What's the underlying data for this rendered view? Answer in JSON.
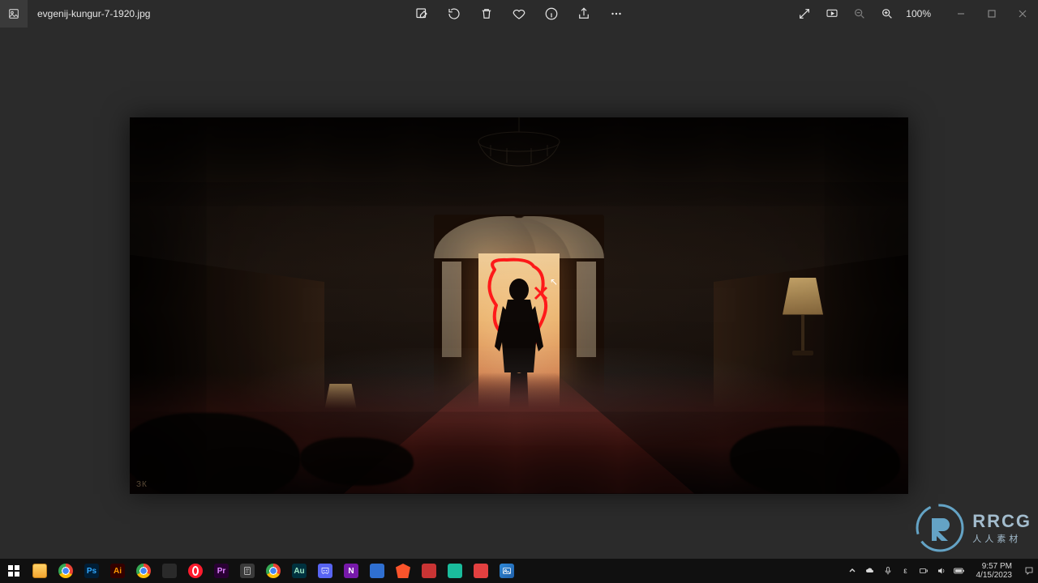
{
  "titlebar": {
    "filename": "evgenij-kungur-7-1920.jpg",
    "zoom_level": "100%"
  },
  "toolbar_icons": {
    "edit": "edit-icon",
    "rotate": "rotate-icon",
    "delete": "delete-icon",
    "favorite": "favorite-icon",
    "info": "info-icon",
    "share": "share-icon",
    "more": "more-icon",
    "fullscreen": "fullscreen-icon",
    "slideshow": "slideshow-icon",
    "zoom_out": "zoom-out-icon",
    "zoom_in": "zoom-in-icon"
  },
  "window_controls": {
    "minimize": "minimize",
    "maximize": "maximize",
    "close": "close"
  },
  "artwork": {
    "signature": "ЗК"
  },
  "taskbar": {
    "items": [
      {
        "name": "start",
        "label": ""
      },
      {
        "name": "file-explorer",
        "label": "",
        "bg": "#f8c155"
      },
      {
        "name": "chrome-1",
        "label": "",
        "bg": "#ffffff"
      },
      {
        "name": "photoshop",
        "label": "Ps",
        "bg": "#001e36",
        "fg": "#31a8ff"
      },
      {
        "name": "illustrator",
        "label": "Ai",
        "bg": "#330000",
        "fg": "#ff9a00"
      },
      {
        "name": "chrome-2",
        "label": "",
        "bg": "#ffffff"
      },
      {
        "name": "app-dark-1",
        "label": "",
        "bg": "#2a2a2a"
      },
      {
        "name": "opera",
        "label": "",
        "bg": "#ff1b2d"
      },
      {
        "name": "premiere",
        "label": "Pr",
        "bg": "#2a0034",
        "fg": "#e085ff"
      },
      {
        "name": "calculator",
        "label": "",
        "bg": "#3a3a3a"
      },
      {
        "name": "chrome-3",
        "label": "",
        "bg": "#ffffff"
      },
      {
        "name": "audition",
        "label": "Au",
        "bg": "#00323f",
        "fg": "#9fe8c6"
      },
      {
        "name": "discord",
        "label": "",
        "bg": "#5865f2"
      },
      {
        "name": "onenote",
        "label": "N",
        "bg": "#7719aa",
        "fg": "#ffffff"
      },
      {
        "name": "app-blue-1",
        "label": "",
        "bg": "#2f6fd0"
      },
      {
        "name": "brave",
        "label": "",
        "bg": "#fb542b"
      },
      {
        "name": "app-red-1",
        "label": "",
        "bg": "#c93434"
      },
      {
        "name": "app-teal-1",
        "label": "",
        "bg": "#1abc9c"
      },
      {
        "name": "app-red-2",
        "label": "",
        "bg": "#e24040"
      },
      {
        "name": "photos",
        "label": "",
        "bg": "#3373c4"
      }
    ],
    "tray": {
      "time": "9:57 PM",
      "date": "4/15/2023"
    }
  },
  "watermark": {
    "text": "RRCG",
    "sub": "人人素材"
  }
}
